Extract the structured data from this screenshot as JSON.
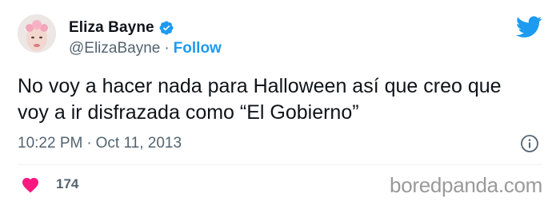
{
  "user": {
    "display_name": "Eliza Bayne",
    "handle": "@ElizaBayne",
    "separator": "·",
    "follow_label": "Follow"
  },
  "tweet": {
    "text": "No voy a hacer nada para Halloween así que creo que voy a ir disfrazada como “El Gobierno”",
    "time": "10:22 PM",
    "date_separator": "·",
    "date": "Oct 11, 2013",
    "likes": "174"
  },
  "icons": {
    "verified": "verified-badge-icon",
    "brand": "twitter-bird-icon",
    "info": "info-icon",
    "like": "heart-icon"
  },
  "colors": {
    "accent": "#1d9bf0",
    "heart": "#f91880",
    "muted": "#536471"
  },
  "watermark": "boredpanda.com"
}
